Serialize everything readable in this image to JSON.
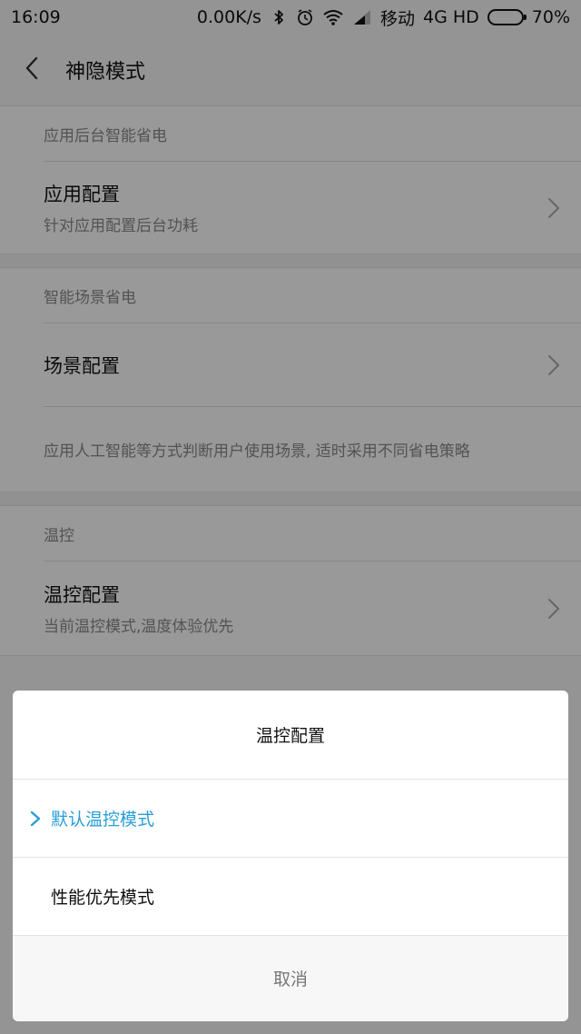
{
  "status_bar": {
    "time": "16:09",
    "speed": "0.00K/s",
    "carrier": "移动",
    "network": "4G HD",
    "battery_percent_text": "70%",
    "battery_level": 0.7,
    "icons": [
      "bluetooth-icon",
      "alarm-icon",
      "wifi-icon",
      "signal-icon",
      "battery-icon"
    ]
  },
  "header": {
    "title": "神隐模式",
    "back_icon": "chevron-left-icon"
  },
  "sections": [
    {
      "label": "应用后台智能省电",
      "row": {
        "title": "应用配置",
        "subtitle": "针对应用配置后台功耗"
      }
    },
    {
      "label": "智能场景省电",
      "row": {
        "title": "场景配置"
      },
      "description": "应用人工智能等方式判断用户使用场景, 适时采用不同省电策略"
    },
    {
      "label": "温控",
      "row": {
        "title": "温控配置",
        "subtitle": "当前温控模式,温度体验优先"
      }
    }
  ],
  "dialog": {
    "title": "温控配置",
    "options": [
      {
        "label": "默认温控模式",
        "selected": true
      },
      {
        "label": "性能优先模式",
        "selected": false
      }
    ],
    "cancel_label": "取消"
  },
  "colors": {
    "accent": "#2a9ed8",
    "text_primary": "#111111",
    "text_secondary": "#8a8a8a",
    "overlay": "rgba(0,0,0,0.40)"
  }
}
